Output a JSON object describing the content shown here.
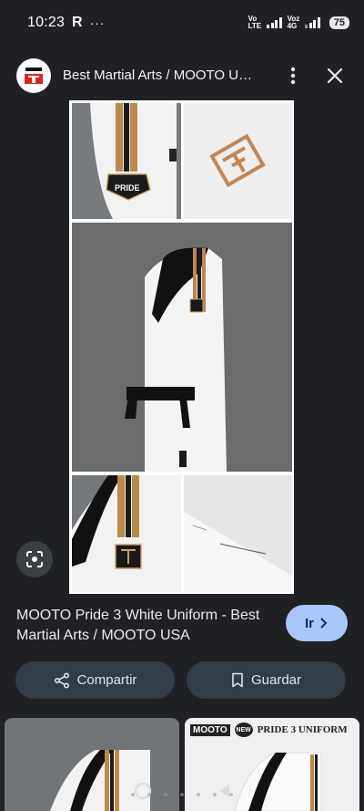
{
  "status": {
    "time": "10:23",
    "app_letter": "R",
    "dots": "···",
    "net1_top": "Vo",
    "net1_bottom": "LTE",
    "net2_top": "Voz",
    "net2_bottom": "4G",
    "net2_super": "4G",
    "battery": "75"
  },
  "header": {
    "title": "Best Martial Arts / MOOTO USA",
    "logo_text": "MOOTO"
  },
  "image": {
    "badge_text": "PRIDE"
  },
  "result": {
    "title": "MOOTO Pride 3 White Uniform - Best Martial Arts / MOOTO USA",
    "go_label": "Ir"
  },
  "actions": {
    "share_label": "Compartir",
    "save_label": "Guardar"
  },
  "related": {
    "item2_brand": "MOOTO",
    "item2_badge": "NEW",
    "item2_label": "PRIDE 3 UNIFORM"
  },
  "colors": {
    "background": "#1f2124",
    "accent_button": "#a8c7fa",
    "action_button": "#333d48"
  }
}
